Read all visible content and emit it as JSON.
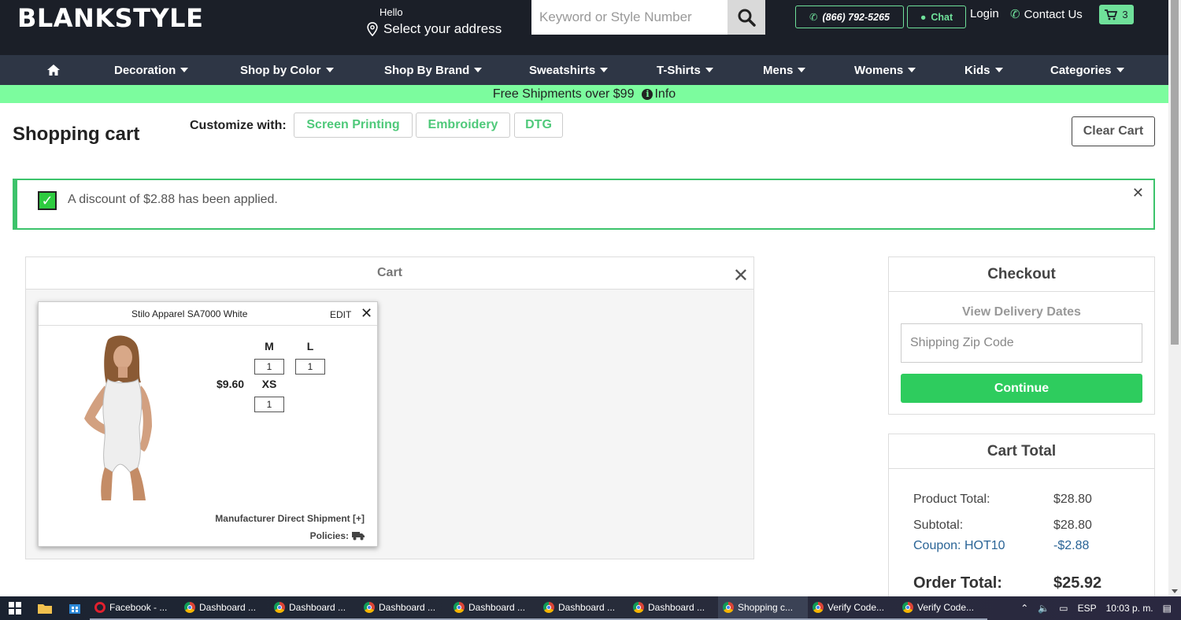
{
  "header": {
    "logo": "BLANKSTYLE",
    "greeting": "Hello",
    "address": "Select your address",
    "search_placeholder": "Keyword or Style Number",
    "phone": "(866) 792-5265",
    "chat": "Chat",
    "login": "Login",
    "contact": "Contact Us",
    "cart_count": "3"
  },
  "nav": {
    "items": [
      "Decoration",
      "Shop by Color",
      "Shop By Brand",
      "Sweatshirts",
      "T-Shirts",
      "Mens",
      "Womens",
      "Kids",
      "Categories"
    ]
  },
  "promo": {
    "text": "Free Shipments over $99",
    "info": "Info"
  },
  "page": {
    "title": "Shopping cart",
    "customize_label": "Customize with:",
    "customize_options": [
      "Screen Printing",
      "Embroidery",
      "DTG"
    ],
    "clear_cart": "Clear Cart"
  },
  "alert": {
    "message": "A discount of $2.88 has been applied."
  },
  "cart": {
    "title": "Cart",
    "item": {
      "name": "Stilo Apparel SA7000 White",
      "edit": "EDIT",
      "price": "$9.60",
      "sizes": [
        {
          "size": "M",
          "qty": "1"
        },
        {
          "size": "L",
          "qty": "1"
        },
        {
          "size": "XS",
          "qty": "1"
        }
      ],
      "shipment": "Manufacturer Direct Shipment [+]",
      "policies": "Policies:"
    }
  },
  "checkout": {
    "title": "Checkout",
    "delivery_label": "View Delivery Dates",
    "zip_placeholder": "Shipping Zip Code",
    "continue": "Continue"
  },
  "totals": {
    "title": "Cart Total",
    "product_total_label": "Product Total:",
    "product_total": "$28.80",
    "subtotal_label": "Subtotal:",
    "subtotal": "$28.80",
    "coupon_label": "Coupon: HOT10",
    "coupon": "-$2.88",
    "order_total_label": "Order Total:",
    "order_total": "$25.92"
  },
  "taskbar": {
    "tasks": [
      "Facebook - ...",
      "Dashboard ...",
      "Dashboard ...",
      "Dashboard ...",
      "Dashboard ...",
      "Dashboard ...",
      "Dashboard ...",
      "Shopping c...",
      "Verify Code...",
      "Verify Code..."
    ],
    "language": "ESP",
    "clock": "10:03 p. m."
  },
  "colors": {
    "header_bg": "#1b1f28",
    "nav_bg": "#2e3645",
    "accent_green": "#7cfc9e",
    "button_green": "#2ecc5e"
  }
}
